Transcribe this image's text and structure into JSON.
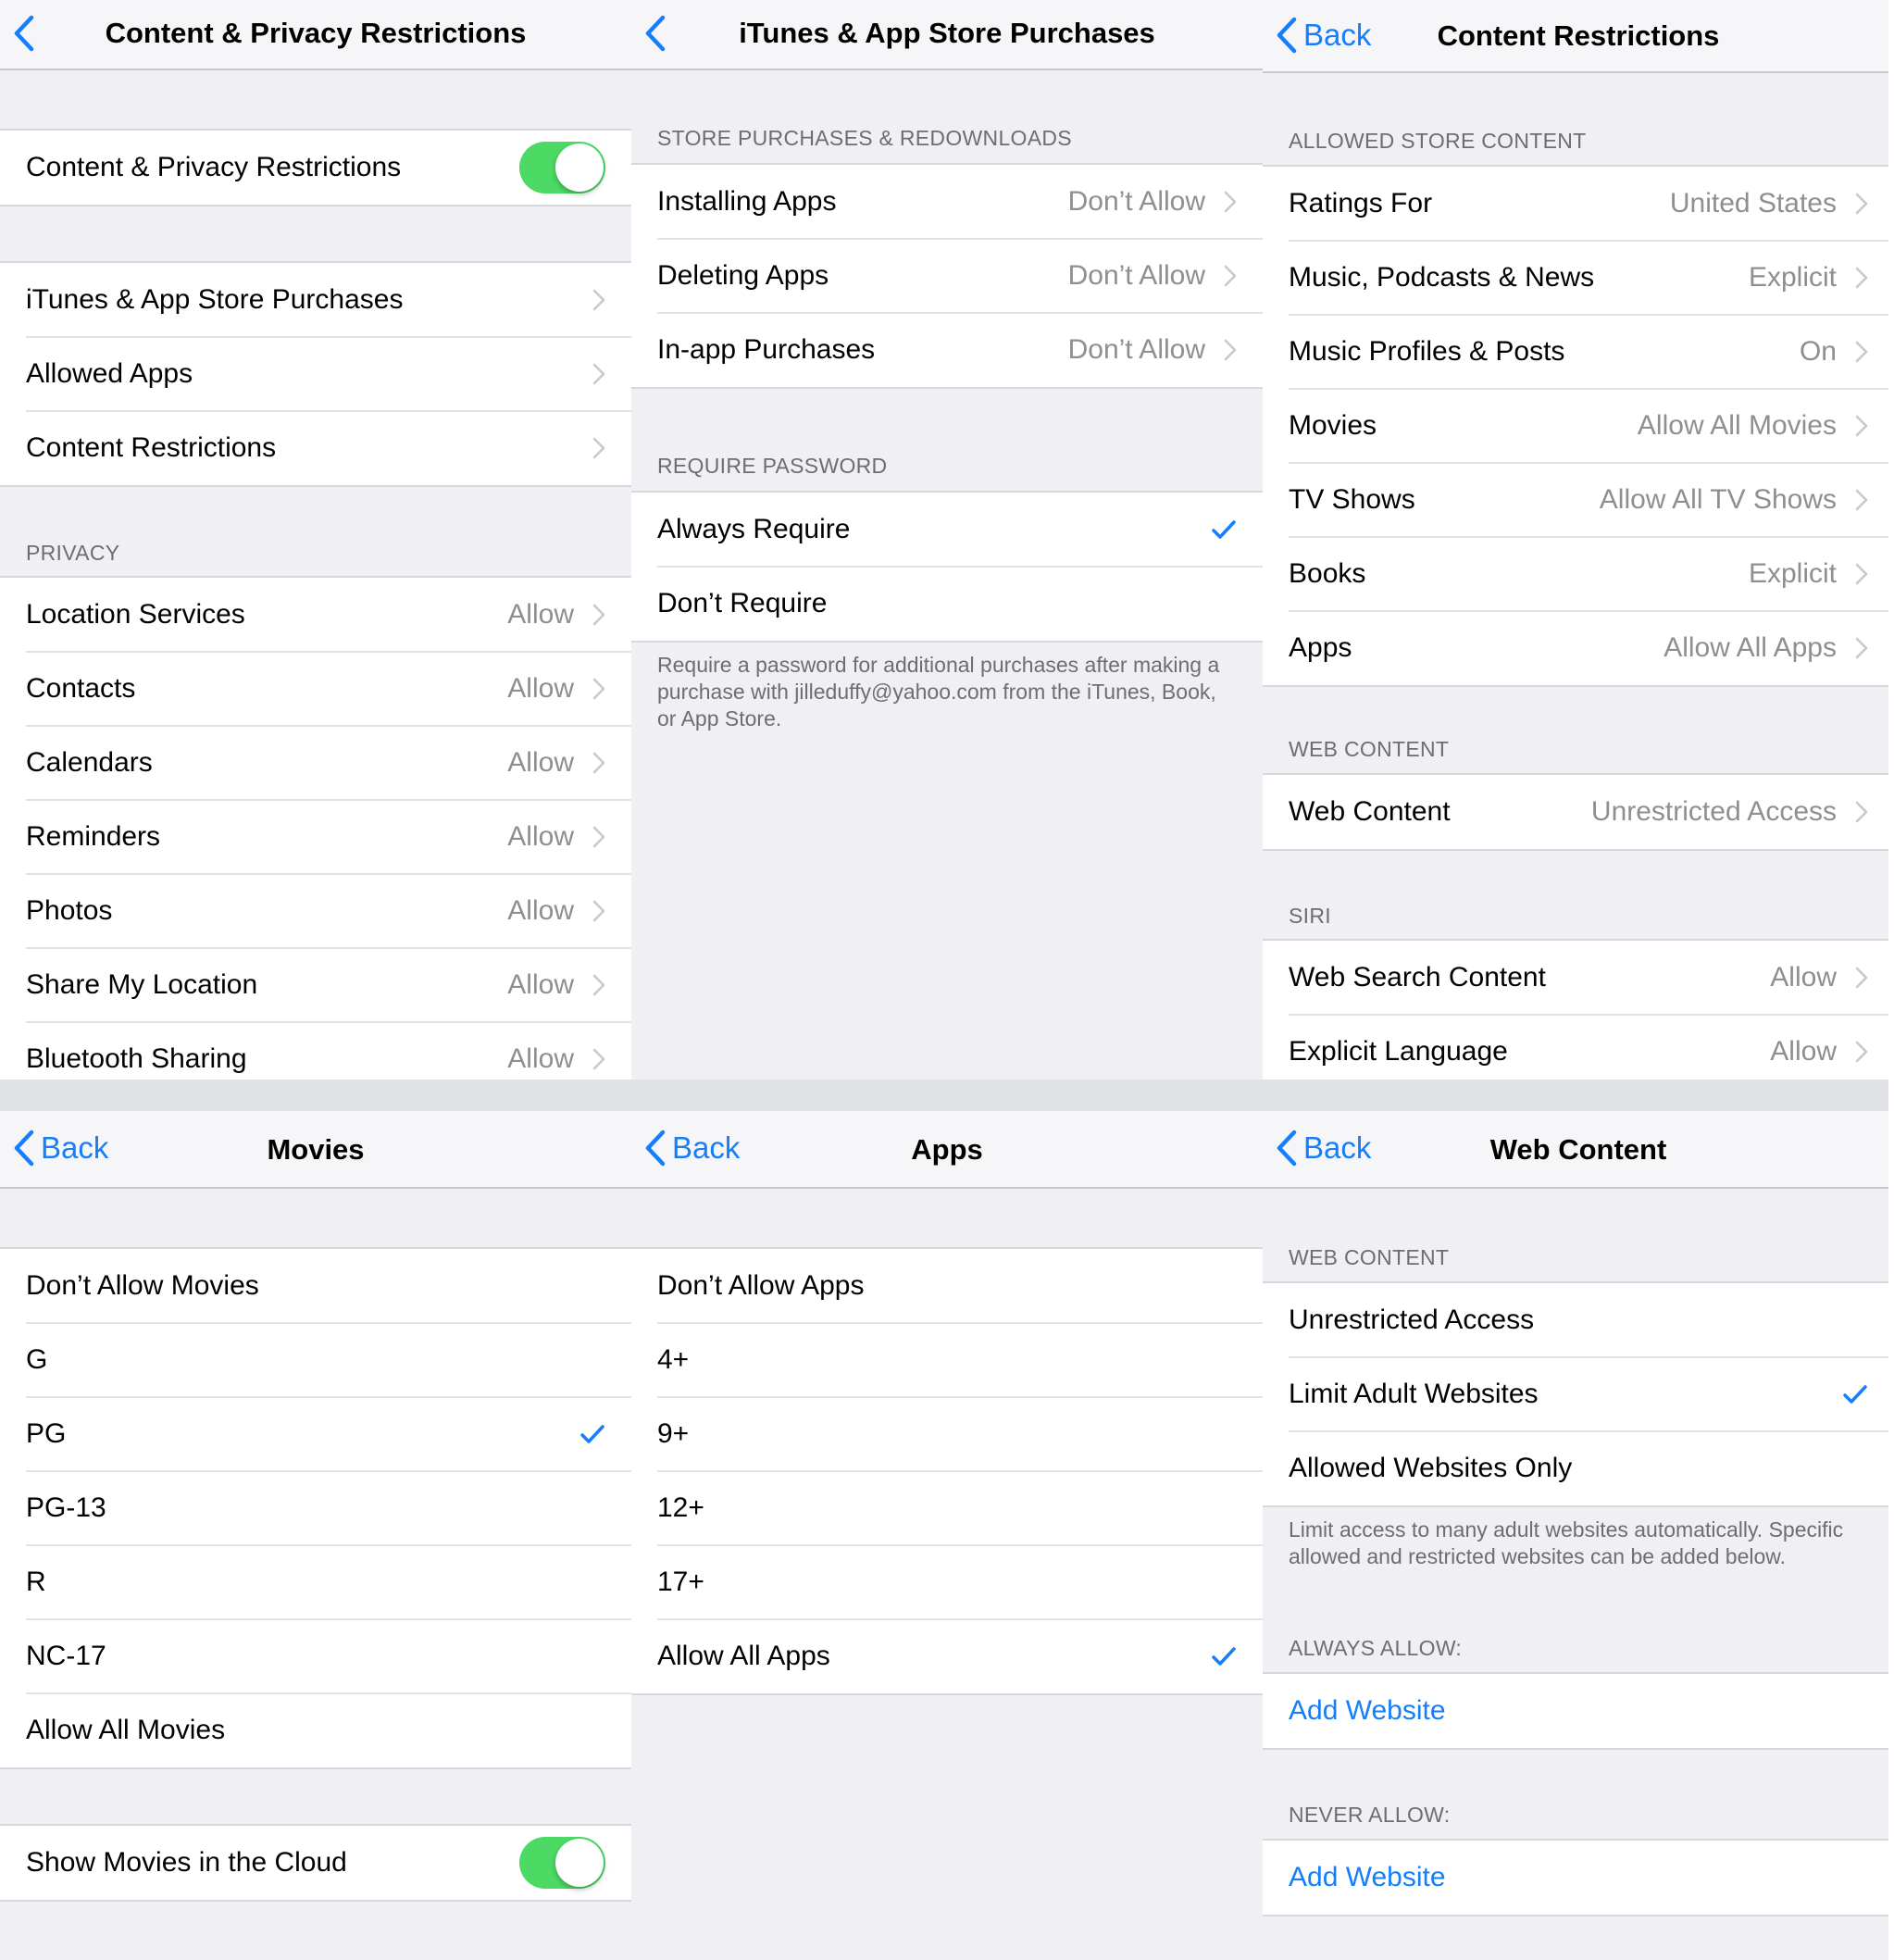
{
  "colors": {
    "accent": "#147efb",
    "toggle_on": "#4cd964",
    "secondary_text": "#8e8e93",
    "group_bg": "#efeff4"
  },
  "panels": {
    "content_privacy": {
      "title": "Content & Privacy Restrictions",
      "master_toggle": {
        "label": "Content & Privacy Restrictions",
        "on": true
      },
      "nav_items": [
        {
          "label": "iTunes & App Store Purchases"
        },
        {
          "label": "Allowed Apps"
        },
        {
          "label": "Content Restrictions"
        }
      ],
      "privacy_header": "PRIVACY",
      "privacy_items": [
        {
          "label": "Location Services",
          "value": "Allow"
        },
        {
          "label": "Contacts",
          "value": "Allow"
        },
        {
          "label": "Calendars",
          "value": "Allow"
        },
        {
          "label": "Reminders",
          "value": "Allow"
        },
        {
          "label": "Photos",
          "value": "Allow"
        },
        {
          "label": "Share My Location",
          "value": "Allow"
        },
        {
          "label": "Bluetooth Sharing",
          "value": "Allow"
        }
      ]
    },
    "itunes_purchases": {
      "title": "iTunes & App Store Purchases",
      "store_header": "STORE PURCHASES & REDOWNLOADS",
      "store_items": [
        {
          "label": "Installing Apps",
          "value": "Don’t Allow"
        },
        {
          "label": "Deleting Apps",
          "value": "Don’t Allow"
        },
        {
          "label": "In-app Purchases",
          "value": "Don’t Allow"
        }
      ],
      "password_header": "REQUIRE PASSWORD",
      "password_options": [
        {
          "label": "Always Require",
          "selected": true
        },
        {
          "label": "Don’t Require",
          "selected": false
        }
      ],
      "password_footer": "Require a password for additional purchases after making a purchase with jilleduffy@yahoo.com from the iTunes, Book, or App Store."
    },
    "content_restrictions": {
      "back_label": "Back",
      "title": "Content Restrictions",
      "store_header": "ALLOWED STORE CONTENT",
      "store_items": [
        {
          "label": "Ratings For",
          "value": "United States"
        },
        {
          "label": "Music, Podcasts & News",
          "value": "Explicit"
        },
        {
          "label": "Music Profiles & Posts",
          "value": "On"
        },
        {
          "label": "Movies",
          "value": "Allow All Movies"
        },
        {
          "label": "TV Shows",
          "value": "Allow All TV Shows"
        },
        {
          "label": "Books",
          "value": "Explicit"
        },
        {
          "label": "Apps",
          "value": "Allow All Apps"
        }
      ],
      "web_header": "WEB CONTENT",
      "web_items": [
        {
          "label": "Web Content",
          "value": "Unrestricted Access"
        }
      ],
      "siri_header": "SIRI",
      "siri_items": [
        {
          "label": "Web Search Content",
          "value": "Allow"
        },
        {
          "label": "Explicit Language",
          "value": "Allow"
        }
      ]
    },
    "movies": {
      "back_label": "Back",
      "title": "Movies",
      "options": [
        {
          "label": "Don’t Allow Movies",
          "selected": false
        },
        {
          "label": "G",
          "selected": false
        },
        {
          "label": "PG",
          "selected": true
        },
        {
          "label": "PG-13",
          "selected": false
        },
        {
          "label": "R",
          "selected": false
        },
        {
          "label": "NC-17",
          "selected": false
        },
        {
          "label": "Allow All Movies",
          "selected": false
        }
      ],
      "cloud_toggle": {
        "label": "Show Movies in the Cloud",
        "on": true
      }
    },
    "apps": {
      "back_label": "Back",
      "title": "Apps",
      "options": [
        {
          "label": "Don’t Allow Apps",
          "selected": false
        },
        {
          "label": "4+",
          "selected": false
        },
        {
          "label": "9+",
          "selected": false
        },
        {
          "label": "12+",
          "selected": false
        },
        {
          "label": "17+",
          "selected": false
        },
        {
          "label": "Allow All Apps",
          "selected": true
        }
      ]
    },
    "web_content": {
      "back_label": "Back",
      "title": "Web Content",
      "header": "WEB CONTENT",
      "options": [
        {
          "label": "Unrestricted Access",
          "selected": false
        },
        {
          "label": "Limit Adult Websites",
          "selected": true
        },
        {
          "label": "Allowed Websites Only",
          "selected": false
        }
      ],
      "footer": "Limit access to many adult websites automatically. Specific allowed and restricted websites can be added below.",
      "always_allow_header": "ALWAYS ALLOW:",
      "always_allow_action": "Add Website",
      "never_allow_header": "NEVER ALLOW:",
      "never_allow_action": "Add Website"
    }
  }
}
